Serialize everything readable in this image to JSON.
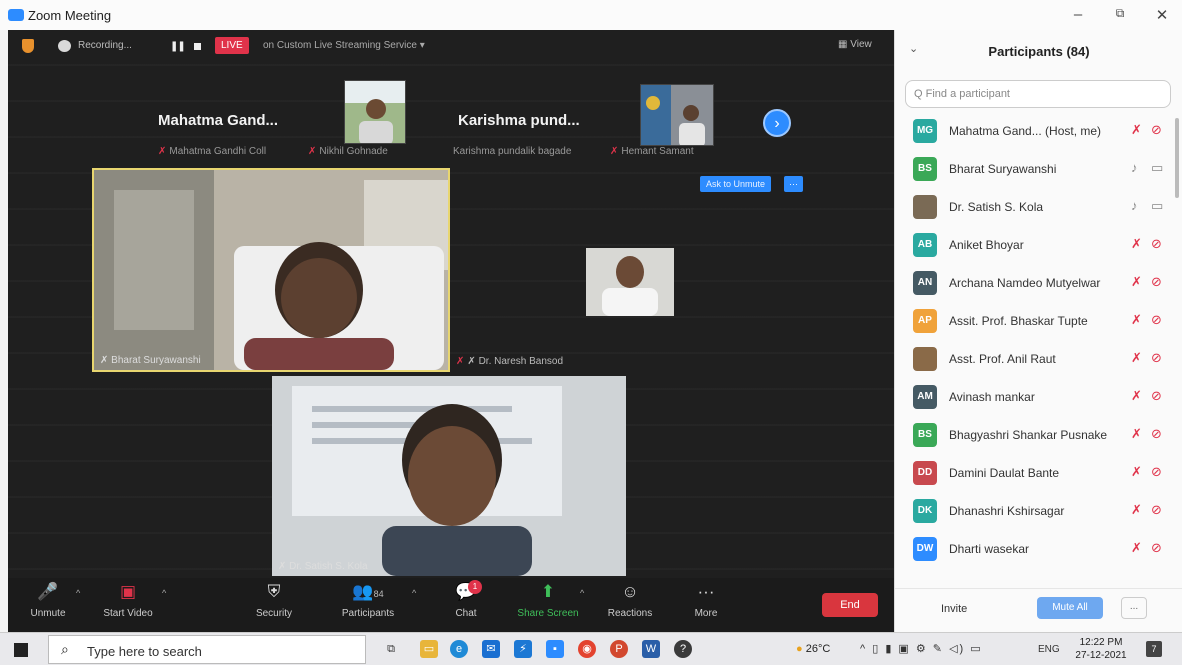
{
  "window": {
    "title": "Zoom Meeting",
    "minimize": "–",
    "restore": "⧉",
    "close": "✕"
  },
  "topbar": {
    "recording": "Recording...",
    "live": "LIVE",
    "stream": "on Custom Live Streaming Service ▾",
    "view": "▦ View"
  },
  "gallery_top": {
    "tile1_name": "Mahatma Gand...",
    "tile2_name": "Karishma pund...",
    "sub1": "Mahatma Gandhi Coll",
    "sub2": "Nikhil Gohnade",
    "sub3": "Karishma pundalik bagade",
    "sub4": "Hemant Samant",
    "next": "›",
    "ask_unmute": "Ask to Unmute",
    "more": "···"
  },
  "videos": {
    "v1_name": "Bharat Suryawanshi",
    "v2_name": "Dr. Naresh Bansod",
    "v3_name": "Dr. Satish S. Kola"
  },
  "controls": {
    "unmute": "Unmute",
    "start_video": "Start Video",
    "security": "Security",
    "participants": "Participants",
    "participants_count": "84",
    "chat": "Chat",
    "chat_badge": "1",
    "share_screen": "Share Screen",
    "reactions": "Reactions",
    "more": "More",
    "end": "End"
  },
  "panel": {
    "title": "Participants (84)",
    "search_placeholder": "Q Find a participant",
    "invite": "Invite",
    "mute_all": "Mute All",
    "more": "...",
    "participants": [
      {
        "initials": "MG",
        "color": "#2aa9a0",
        "name": "Mahatma Gand... (Host, me)",
        "mic": "off",
        "cam": "off"
      },
      {
        "initials": "BS",
        "color": "#3aa857",
        "name": "Bharat Suryawanshi",
        "mic": "on",
        "cam": "on"
      },
      {
        "initials": "",
        "color": "#7a6a55",
        "name": "Dr. Satish S. Kola",
        "mic": "on",
        "cam": "on"
      },
      {
        "initials": "AB",
        "color": "#2aa9a0",
        "name": "Aniket Bhoyar",
        "mic": "off",
        "cam": "off"
      },
      {
        "initials": "AN",
        "color": "#455a64",
        "name": "Archana Namdeo Mutyelwar",
        "mic": "off",
        "cam": "off"
      },
      {
        "initials": "AP",
        "color": "#f0a23a",
        "name": "Assit. Prof. Bhaskar Tupte",
        "mic": "off",
        "cam": "off"
      },
      {
        "initials": "",
        "color": "#8a6a48",
        "name": "Asst. Prof. Anil Raut",
        "mic": "off",
        "cam": "off"
      },
      {
        "initials": "AM",
        "color": "#455a64",
        "name": "Avinash mankar",
        "mic": "off",
        "cam": "off"
      },
      {
        "initials": "BS",
        "color": "#3aa857",
        "name": "Bhagyashri Shankar Pusnake",
        "mic": "off",
        "cam": "off"
      },
      {
        "initials": "DD",
        "color": "#c8494e",
        "name": "Damini Daulat Bante",
        "mic": "off",
        "cam": "off"
      },
      {
        "initials": "DK",
        "color": "#2aa9a0",
        "name": "Dhanashri Kshirsagar",
        "mic": "off",
        "cam": "off"
      },
      {
        "initials": "DW",
        "color": "#2d8cff",
        "name": "Dharti wasekar",
        "mic": "off",
        "cam": "off"
      }
    ]
  },
  "taskbar": {
    "search_placeholder": "Type here to search",
    "weather": "26°C",
    "lang": "ENG",
    "time": "12:22 PM",
    "date": "27-12-2021",
    "notif": "7"
  },
  "colors": {
    "accent": "#2d8cff",
    "live": "#e0334a",
    "end": "#d9363e",
    "stage": "#1f1f1f"
  }
}
